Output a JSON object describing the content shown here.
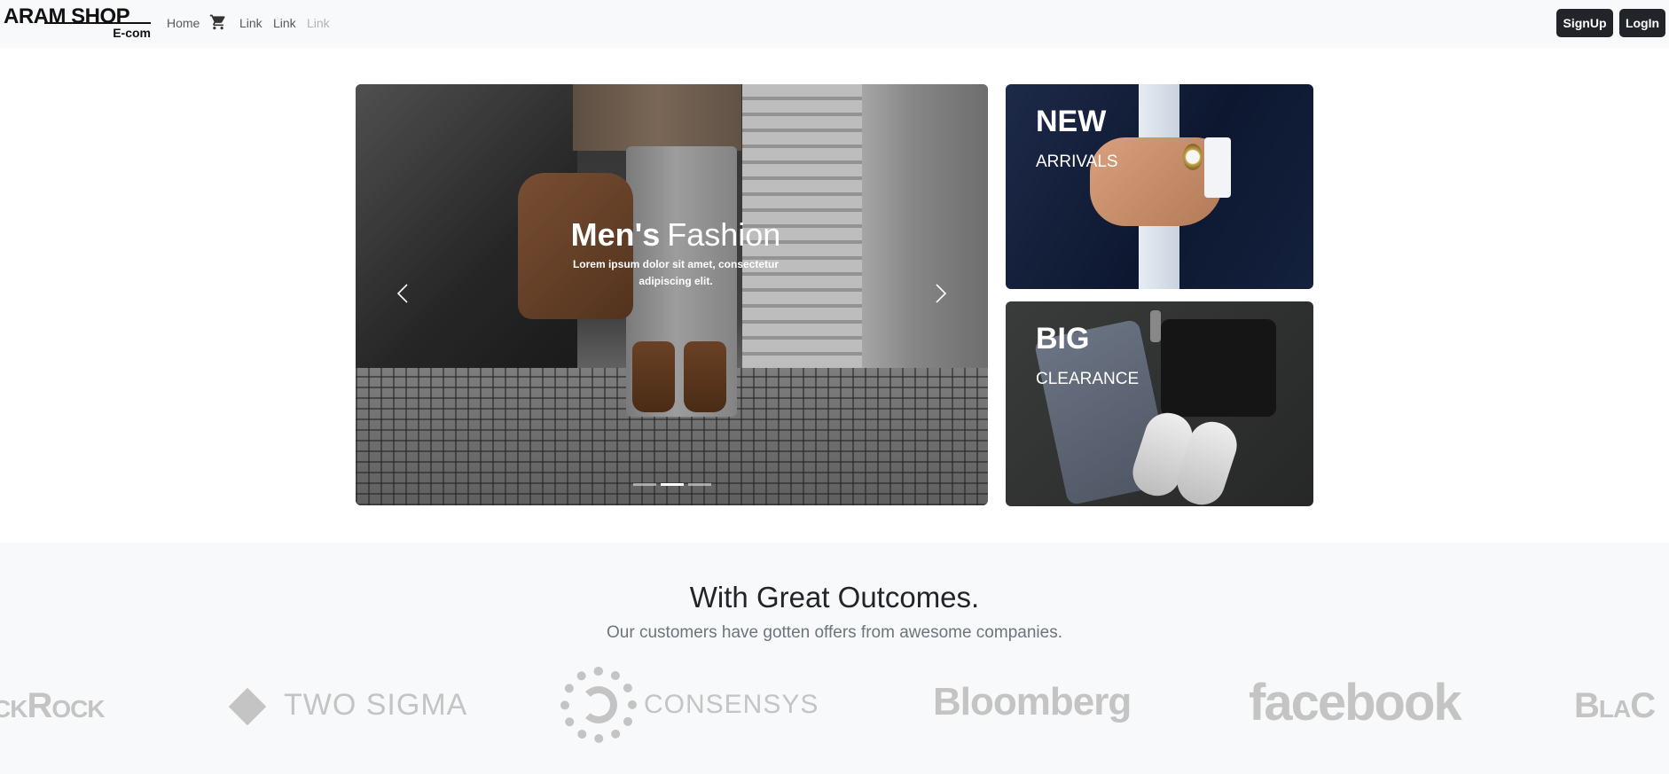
{
  "navbar": {
    "brand_title": "ARAM SHOP",
    "brand_sub": "E-com",
    "links": [
      "Home",
      "Link",
      "Link",
      "Link"
    ],
    "cart_icon": "cart-icon",
    "signup_label": "SignUp",
    "login_label": "LogIn"
  },
  "carousel": {
    "title_bold": "Men's",
    "title_light": "Fashion",
    "text": "Lorem ipsum dolor sit amet, consectetur adipiscing elit.",
    "prev_icon": "chevron-left-icon",
    "next_icon": "chevron-right-icon",
    "slide_count": 3,
    "active_slide": 2
  },
  "promos": {
    "new": {
      "title": "NEW",
      "subtitle": "ARRIVALS"
    },
    "big": {
      "title": "BIG",
      "subtitle": "CLEARANCE"
    }
  },
  "outcomes": {
    "title": "With Great Outcomes.",
    "subtitle": "Our customers have gotten offers from awesome companies.",
    "logos": [
      "ckRock",
      "TWO SIGMA",
      "CONSENSYS",
      "Bloomberg",
      "facebook",
      "BlaC"
    ]
  },
  "colors": {
    "navbar_bg": "#f8f9fa",
    "button_dark": "#212529",
    "muted_text": "#6c757d",
    "logo_gray": "#c4c4c4"
  }
}
